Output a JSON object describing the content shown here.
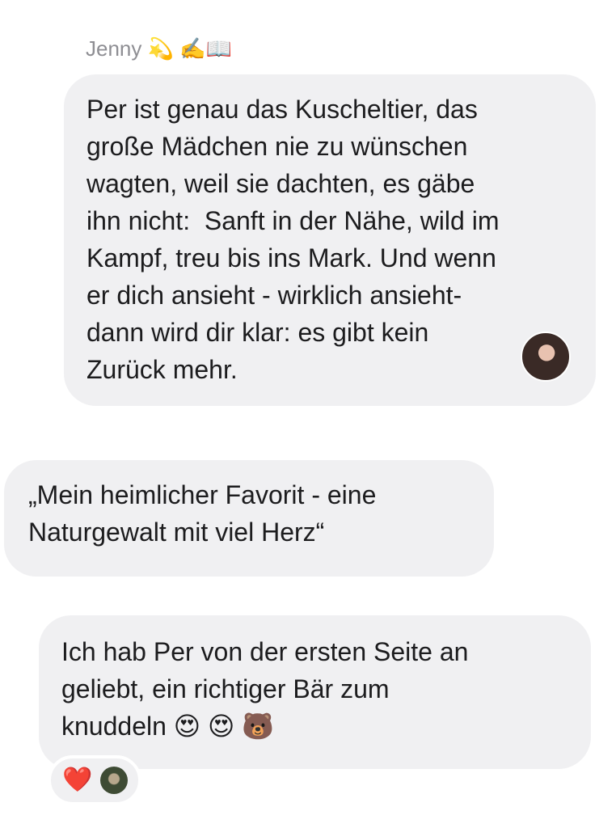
{
  "messages": [
    {
      "sender": "Jenny 💫 ✍️📖",
      "text": "Per ist genau das Kuscheltier, das\ngroße Mädchen nie zu wünschen\nwagten, weil sie dachten, es gäbe\nihn nicht:  Sanft in der Nähe, wild im\nKampf, treu bis ins Mark. Und wenn\ner dich ansieht - wirklich ansieht-\ndann wird dir klar: es gibt kein\nZurück mehr."
    },
    {
      "text": "„Mein heimlicher Favorit - eine\nNaturgewalt mit viel Herz“"
    },
    {
      "text": "Ich hab Per von der ersten Seite an\ngeliebt, ein richtiger Bär zum\nknuddeln 😍 😍 🐻",
      "reaction": "❤️"
    }
  ],
  "colors": {
    "bubble": "#f0f0f2",
    "text": "#1c1c1e",
    "sender_name": "#8e8e93",
    "heart": "#e0242b"
  }
}
